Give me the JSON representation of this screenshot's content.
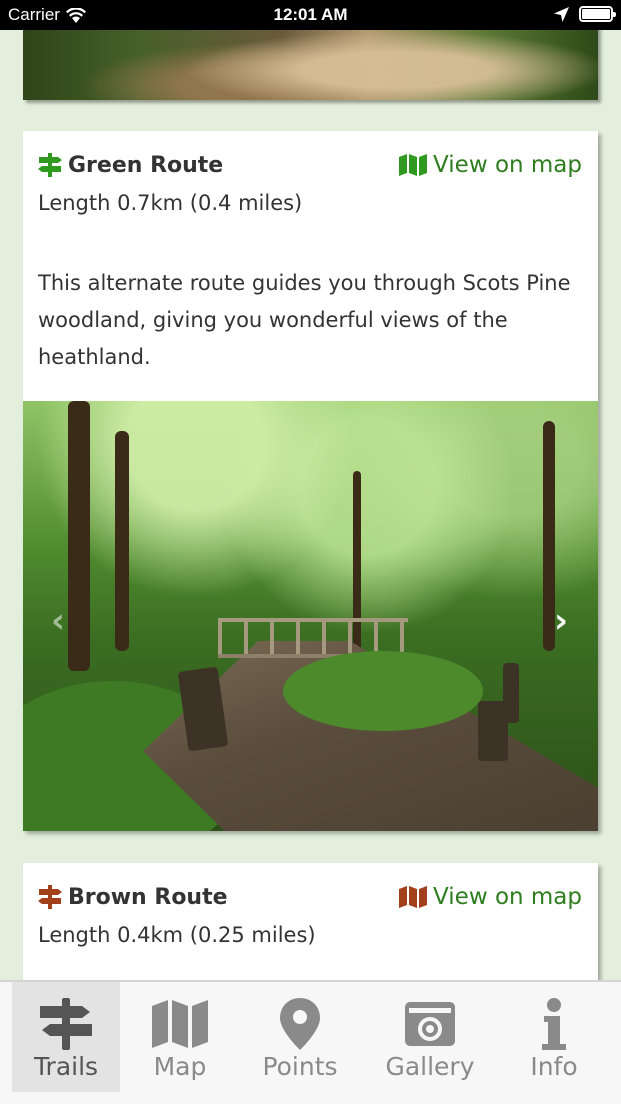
{
  "status_bar": {
    "carrier": "Carrier",
    "time": "12:01 AM"
  },
  "colors": {
    "green_accent": "#2e7d1e",
    "green_icon": "#2f9a1f",
    "brown_icon": "#a3401c",
    "background": "#e3efdc"
  },
  "routes": [
    {
      "title": "Green Route",
      "icon": "signpost-icon",
      "map_link": "View on map",
      "length": "Length 0.7km (0.4 miles)",
      "description": "This alternate route guides you through Scots Pine woodland, giving you wonderful views of the heathland."
    },
    {
      "title": "Brown Route",
      "icon": "signpost-icon",
      "map_link": "View on map",
      "length": "Length 0.4km (0.25 miles)"
    }
  ],
  "carousel": {
    "prev": "‹",
    "next": "›"
  },
  "tabs": [
    {
      "label": "Trails",
      "icon": "signpost-icon",
      "active": true
    },
    {
      "label": "Map",
      "icon": "map-icon",
      "active": false
    },
    {
      "label": "Points",
      "icon": "pin-icon",
      "active": false
    },
    {
      "label": "Gallery",
      "icon": "camera-icon",
      "active": false
    },
    {
      "label": "Info",
      "icon": "info-icon",
      "active": false
    }
  ]
}
